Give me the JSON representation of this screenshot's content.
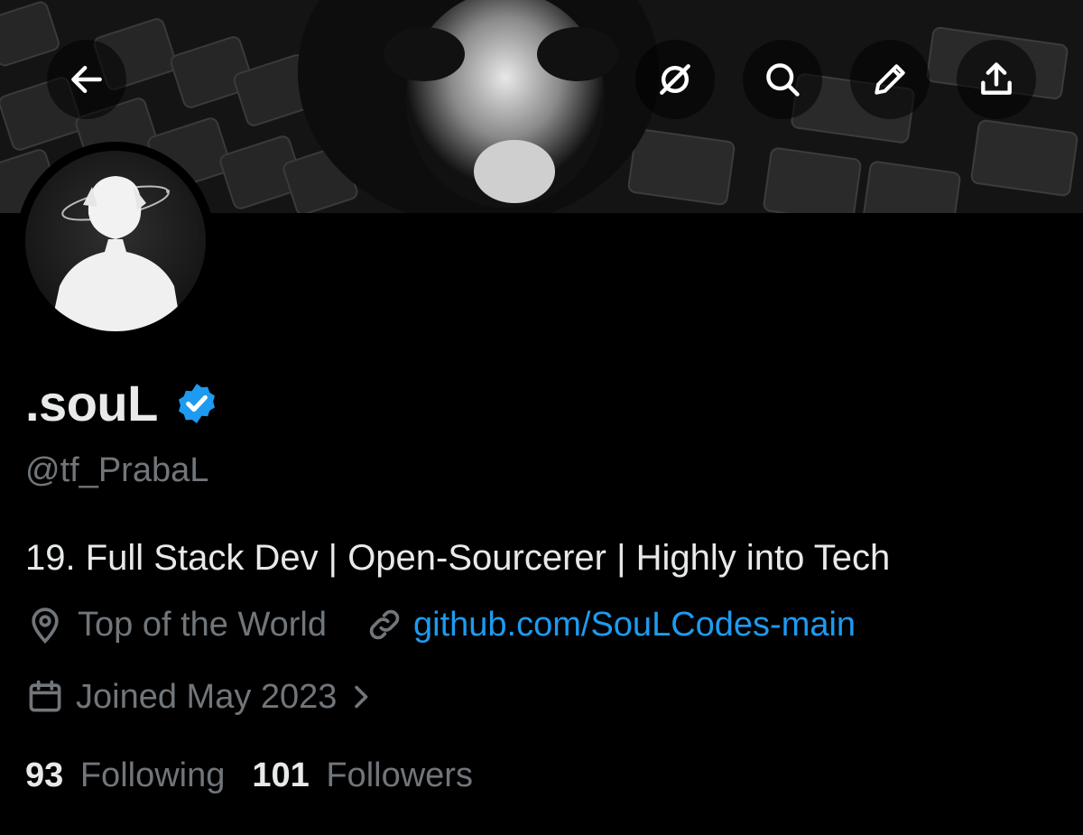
{
  "header": {
    "back_icon": "arrow-left-icon",
    "actions": [
      "grok-icon",
      "search-icon",
      "edit-pencil-icon",
      "share-icon"
    ]
  },
  "profile": {
    "display_name": ".souL",
    "verified_color": "#1d9bf0",
    "handle": "@tf_PrabaL",
    "bio": "19. Full Stack Dev | Open-Sourcerer | Highly into Tech",
    "location": "Top of the World",
    "website": "github.com/SouLCodes-main",
    "joined": "Joined May 2023",
    "following_count": "93",
    "following_label": "Following",
    "followers_count": "101",
    "followers_label": "Followers"
  },
  "colors": {
    "background": "#000000",
    "text": "#e7e9ea",
    "muted": "#71767b",
    "link": "#1d9bf0"
  }
}
